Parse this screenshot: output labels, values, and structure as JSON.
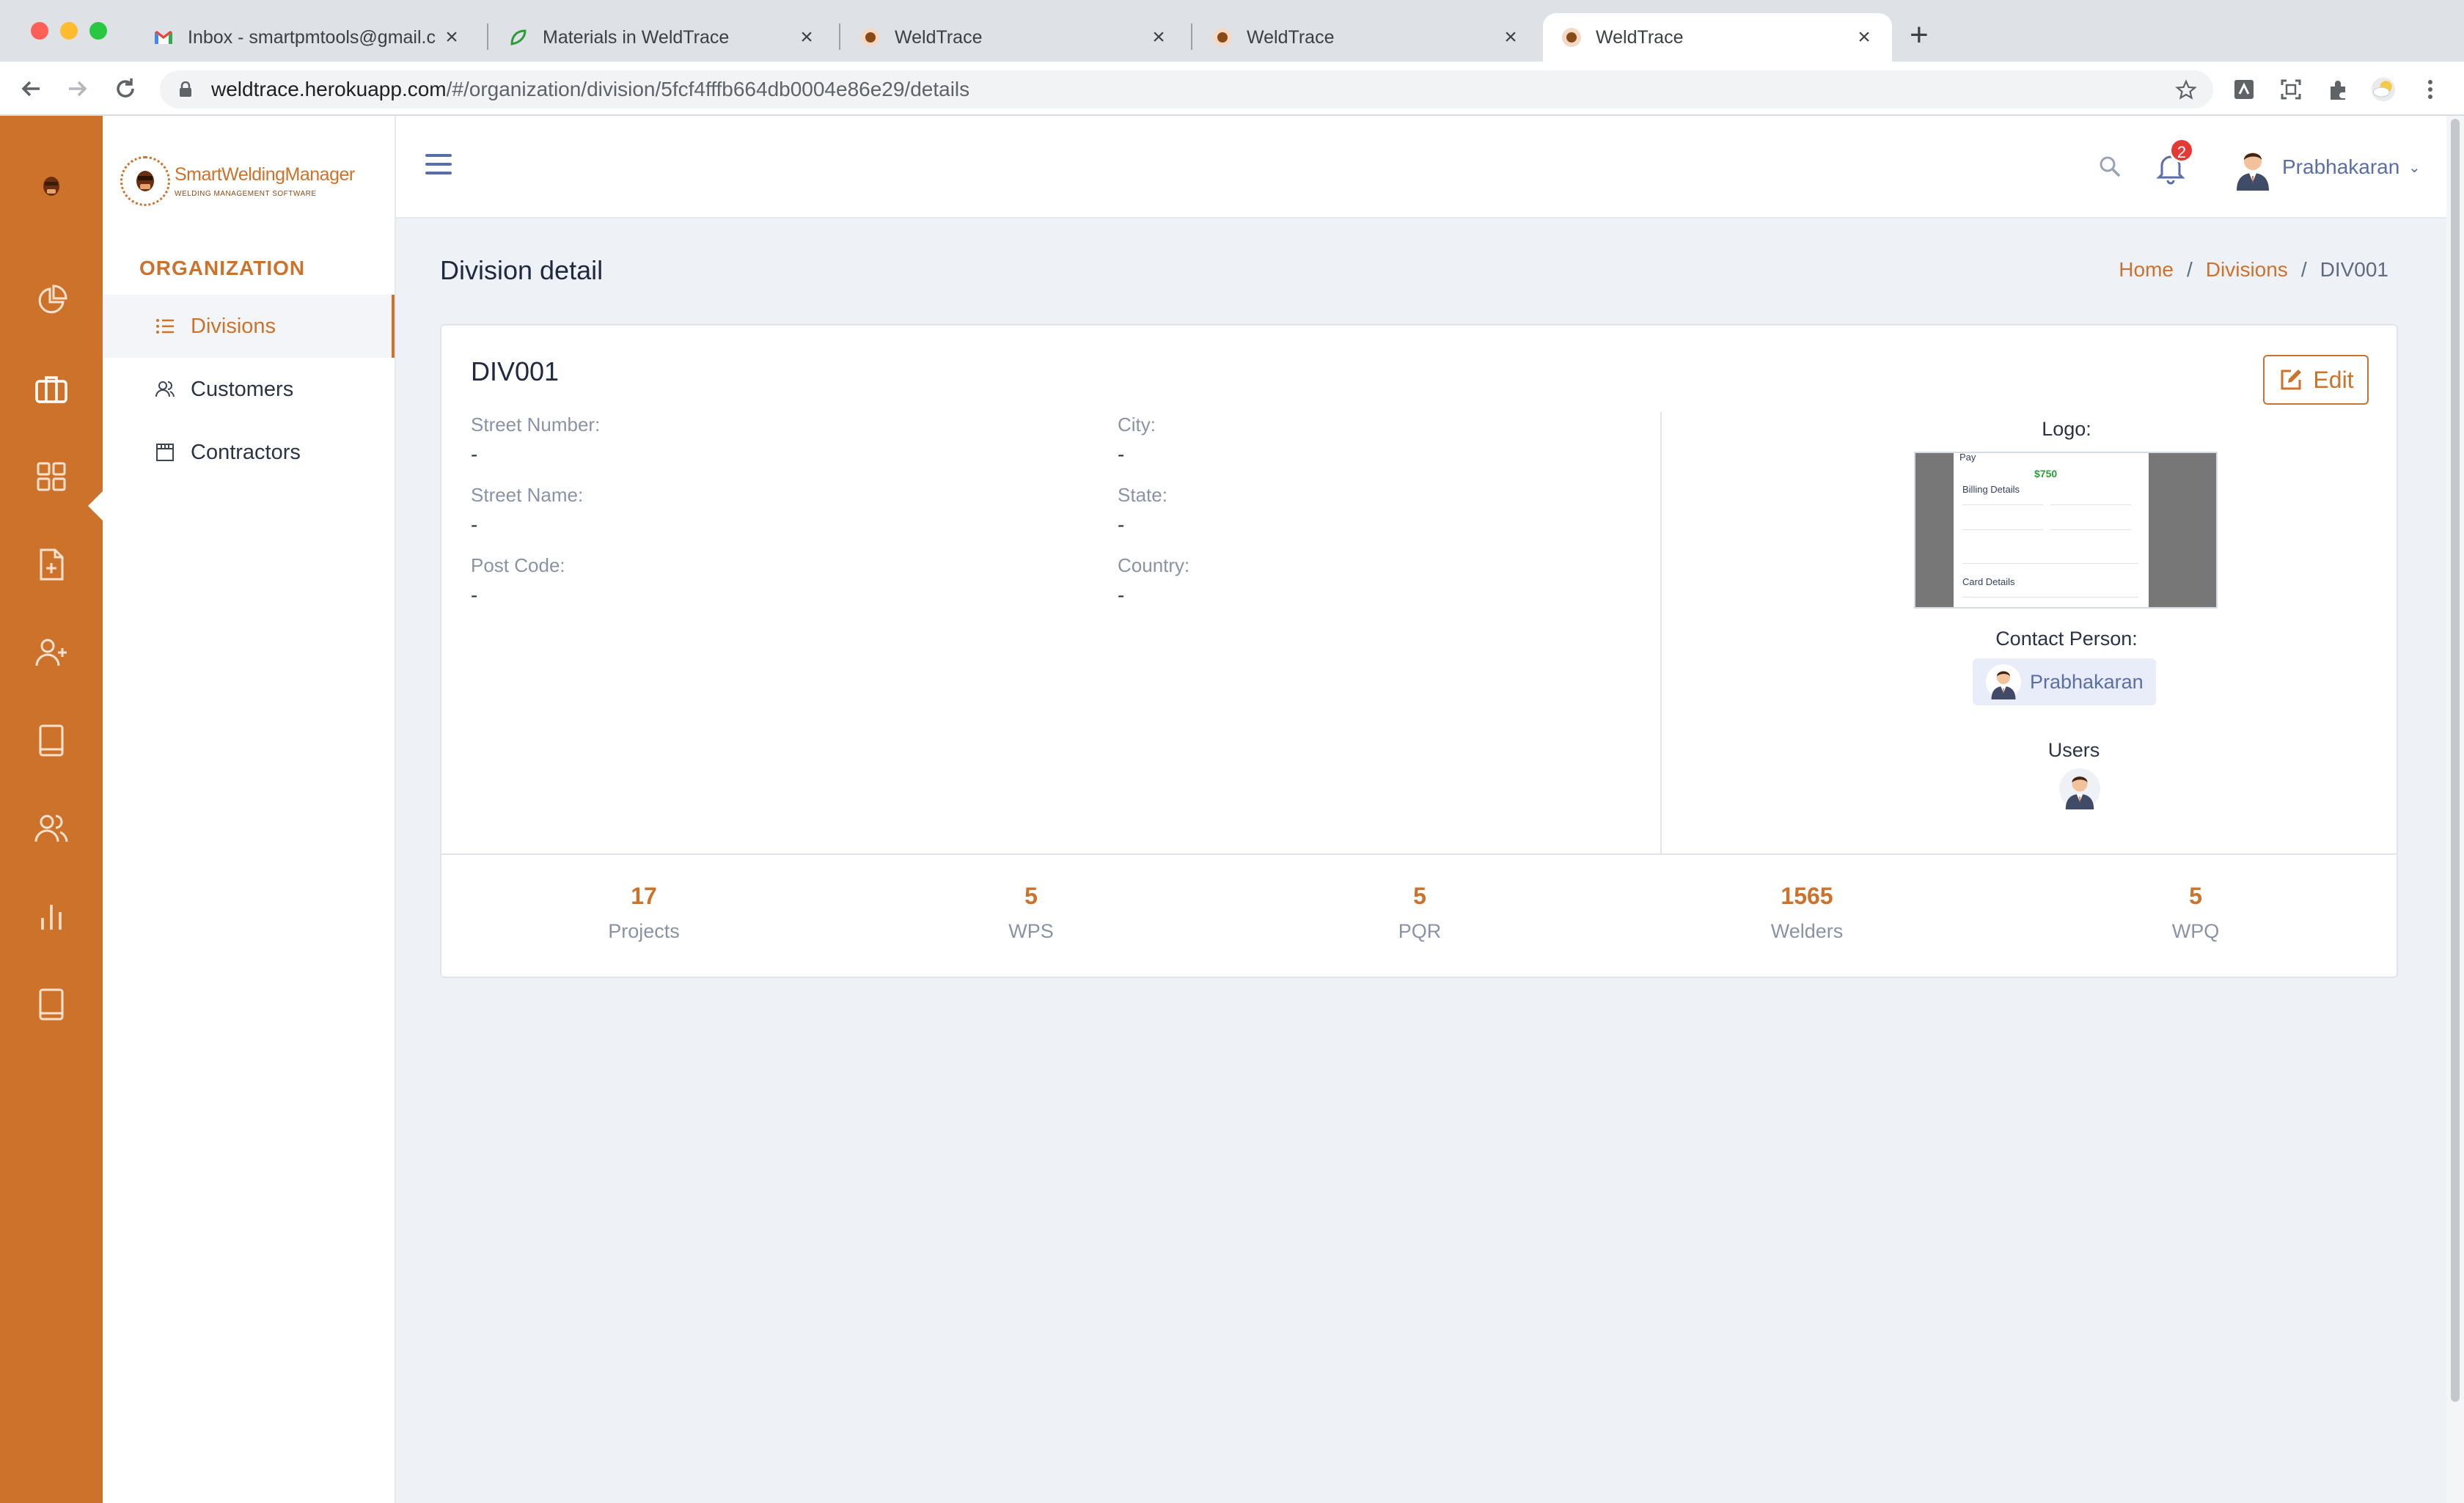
{
  "browser": {
    "tabs": [
      {
        "title": "Inbox - smartpmtools@gmail.c",
        "icon": "gmail-icon"
      },
      {
        "title": "Materials in WeldTrace",
        "icon": "weldtrace-materials-icon"
      },
      {
        "title": "WeldTrace",
        "icon": "weldtrace-icon"
      },
      {
        "title": "WeldTrace",
        "icon": "weldtrace-icon"
      },
      {
        "title": "WeldTrace",
        "icon": "weldtrace-icon",
        "active": true
      }
    ],
    "url_host": "weldtrace.herokuapp.com",
    "url_path": "/#/organization/division/5fcf4fffb664db0004e86e29/details"
  },
  "brand": {
    "name": "SmartWeldingManager",
    "tagline": "WELDING MANAGEMENT SOFTWARE",
    "accent": "#cd722b"
  },
  "subnav": {
    "heading": "ORGANIZATION",
    "items": [
      {
        "label": "Divisions",
        "icon": "list-icon",
        "active": true
      },
      {
        "label": "Customers",
        "icon": "users-icon"
      },
      {
        "label": "Contractors",
        "icon": "calendar-icon"
      }
    ]
  },
  "header": {
    "notification_count": "2",
    "user_name": "Prabhakaran"
  },
  "page": {
    "title": "Division detail",
    "breadcrumb": {
      "home": "Home",
      "divisions": "Divisions",
      "current": "DIV001"
    }
  },
  "division": {
    "code": "DIV001",
    "edit_label": "Edit",
    "fields": {
      "street_number": {
        "label": "Street Number:",
        "value": "-"
      },
      "street_name": {
        "label": "Street Name:",
        "value": "-"
      },
      "post_code": {
        "label": "Post Code:",
        "value": "-"
      },
      "city": {
        "label": "City:",
        "value": "-"
      },
      "state": {
        "label": "State:",
        "value": "-"
      },
      "country": {
        "label": "Country:",
        "value": "-"
      }
    },
    "logo_label": "Logo:",
    "logo_preview": {
      "pay": "Pay",
      "amount": "$750",
      "billing": "Billing Details",
      "card": "Card Details"
    },
    "contact_label": "Contact Person:",
    "contact_name": "Prabhakaran",
    "users_label": "Users"
  },
  "stats": [
    {
      "value": "17",
      "label": "Projects"
    },
    {
      "value": "5",
      "label": "WPS"
    },
    {
      "value": "5",
      "label": "PQR"
    },
    {
      "value": "1565",
      "label": "Welders"
    },
    {
      "value": "5",
      "label": "WPQ"
    }
  ]
}
